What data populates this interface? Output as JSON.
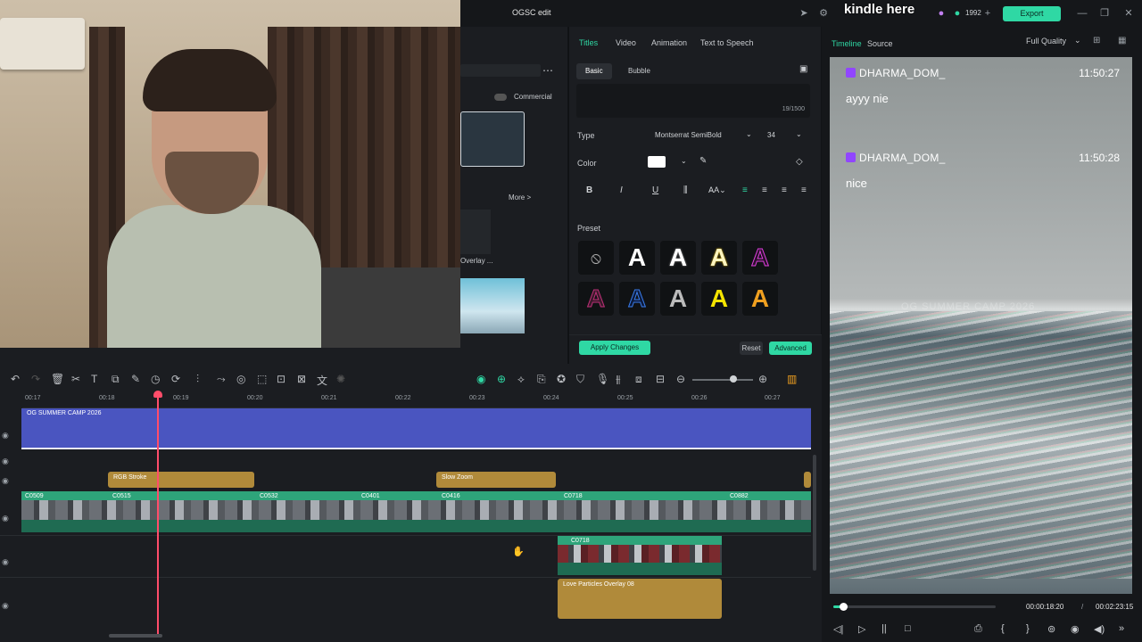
{
  "app": {
    "project_title": "OGSC edit",
    "overlay_text": "kindle here",
    "export_label": "Export",
    "credits": "1992"
  },
  "left_panel": {
    "commercial_label": "Commercial",
    "more_label": "More >",
    "overlay_label": "Overlay ..."
  },
  "titles_panel": {
    "tabs": [
      "Titles",
      "Video",
      "Animation",
      "Text to Speech"
    ],
    "subtabs": [
      "Basic",
      "Bubble"
    ],
    "char_count": "19/1500",
    "type_label": "Type",
    "font_name": "Montserrat SemiBold",
    "font_size": "34",
    "color_label": "Color",
    "color_value": "#ffffff",
    "preset_label": "Preset",
    "preset_letter": "A",
    "apply_label": "Apply Changes",
    "reset_label": "Reset",
    "advanced_label": "Advanced"
  },
  "preview": {
    "tabs": [
      "Timeline",
      "Source"
    ],
    "quality": "Full Quality",
    "chat": [
      {
        "user": "DHARMA_DOM_",
        "time": "11:50:27",
        "message": "ayyy nie"
      },
      {
        "user": "DHARMA_DOM_",
        "time": "11:50:28",
        "message": "nice"
      }
    ],
    "watermark": "OG SUMMER CAMP 2026",
    "current_time": "00:00:18:20",
    "separator": "/",
    "total_time": "00:02:23:15",
    "progress": 0.06
  },
  "timeline": {
    "ruler": [
      "00:17",
      "00:18",
      "00:19",
      "00:20",
      "00:21",
      "00:22",
      "00:23",
      "00:24",
      "00:25",
      "00:26",
      "00:27"
    ],
    "title_clip": "OG SUMMER CAMP 2026",
    "effects": [
      "RGB Stroke",
      "Slow Zoom"
    ],
    "video_clips": [
      "C0509",
      "C0515",
      "C0532",
      "C0401",
      "C0416",
      "C0718",
      "C0882"
    ],
    "overlay_clip": "C0718",
    "overlay_effect": "Love Particles Overlay 08"
  },
  "colors": {
    "accent": "#2fd8a4",
    "playhead": "#ff4d6a",
    "title_track": "#4a55c0",
    "effect_clip": "#b08a3a",
    "video_clip": "#2ea47a"
  }
}
